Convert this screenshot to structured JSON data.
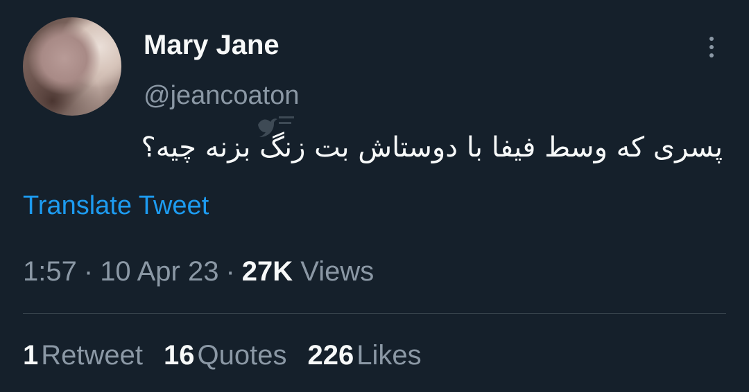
{
  "tweet": {
    "author": {
      "display_name": "Mary Jane",
      "handle": "@jeancoaton",
      "avatar_icon": "blurred-profile-photo"
    },
    "more_icon": "three-dots-vertical-icon",
    "text": "پسری که وسط فیفا با دوستاش بت زنگ بزنه چیه؟",
    "translate_label": "Translate Tweet",
    "time": "1:57",
    "date": "10 Apr 23",
    "separator": "·",
    "views_count": "27K",
    "views_label": "Views",
    "stats": [
      {
        "count": "1",
        "label": "Retweet"
      },
      {
        "count": "16",
        "label": "Quotes"
      },
      {
        "count": "226",
        "label": "Likes"
      }
    ]
  },
  "colors": {
    "background": "#15202b",
    "primary_text": "#f7f9f9",
    "secondary_text": "#8b98a5",
    "link": "#1d9bf0",
    "divider": "#38444d"
  }
}
